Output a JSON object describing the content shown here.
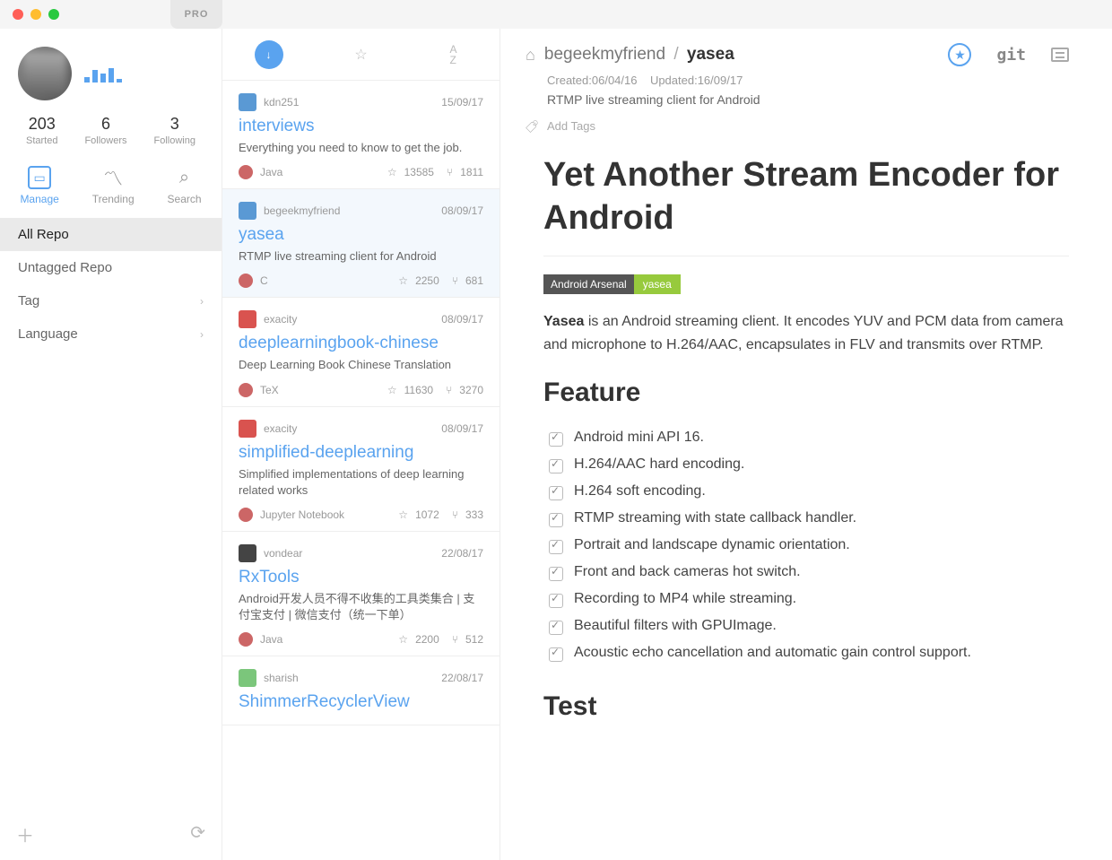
{
  "titlebar": {
    "pro": "PRO"
  },
  "profile": {
    "stats": [
      {
        "num": "203",
        "label": "Started"
      },
      {
        "num": "6",
        "label": "Followers"
      },
      {
        "num": "3",
        "label": "Following"
      }
    ]
  },
  "sidebar_tabs": {
    "manage": "Manage",
    "trending": "Trending",
    "search": "Search"
  },
  "nav": {
    "all_repo": "All Repo",
    "untagged": "Untagged Repo",
    "tag": "Tag",
    "language": "Language"
  },
  "repos": [
    {
      "owner": "kdn251",
      "date": "15/09/17",
      "title": "interviews",
      "desc": "Everything you need to know to get the job.",
      "lang": "Java",
      "stars": "13585",
      "forks": "1811",
      "ava": "b"
    },
    {
      "owner": "begeekmyfriend",
      "date": "08/09/17",
      "title": "yasea",
      "desc": "RTMP live streaming client for Android",
      "lang": "C",
      "stars": "2250",
      "forks": "681",
      "ava": "b"
    },
    {
      "owner": "exacity",
      "date": "08/09/17",
      "title": "deeplearningbook-chinese",
      "desc": "Deep Learning Book Chinese Translation",
      "lang": "TeX",
      "stars": "11630",
      "forks": "3270",
      "ava": "r"
    },
    {
      "owner": "exacity",
      "date": "08/09/17",
      "title": "simplified-deeplearning",
      "desc": "Simplified implementations of deep learning related works",
      "lang": "Jupyter Notebook",
      "stars": "1072",
      "forks": "333",
      "ava": "r"
    },
    {
      "owner": "vondear",
      "date": "22/08/17",
      "title": "RxTools",
      "desc": "Android开发人员不得不收集的工具类集合 | 支付宝支付 | 微信支付（统一下单）",
      "lang": "Java",
      "stars": "2200",
      "forks": "512",
      "ava": "k"
    },
    {
      "owner": "sharish",
      "date": "22/08/17",
      "title": "ShimmerRecyclerView",
      "desc": "",
      "lang": "",
      "stars": "",
      "forks": "",
      "ava": "g"
    }
  ],
  "detail": {
    "owner": "begeekmyfriend",
    "repo": "yasea",
    "created_label": "Created:",
    "created": "06/04/16",
    "updated_label": "Updated:",
    "updated": "16/09/17",
    "short": "RTMP live streaming client for Android",
    "add_tags": "Add Tags",
    "readme_title": "Yet Another Stream Encoder for Android",
    "badge_key": "Android Arsenal",
    "badge_val": "yasea",
    "intro_bold": "Yasea",
    "intro_rest": " is an Android streaming client. It encodes YUV and PCM data from camera and microphone to H.264/AAC, encapsulates in FLV and transmits over RTMP.",
    "feature_heading": "Feature",
    "features": [
      "Android mini API 16.",
      "H.264/AAC hard encoding.",
      "H.264 soft encoding.",
      "RTMP streaming with state callback handler.",
      "Portrait and landscape dynamic orientation.",
      "Front and back cameras hot switch.",
      "Recording to MP4 while streaming.",
      "Beautiful filters with GPUImage.",
      "Acoustic echo cancellation and automatic gain control support."
    ],
    "test_heading": "Test"
  }
}
